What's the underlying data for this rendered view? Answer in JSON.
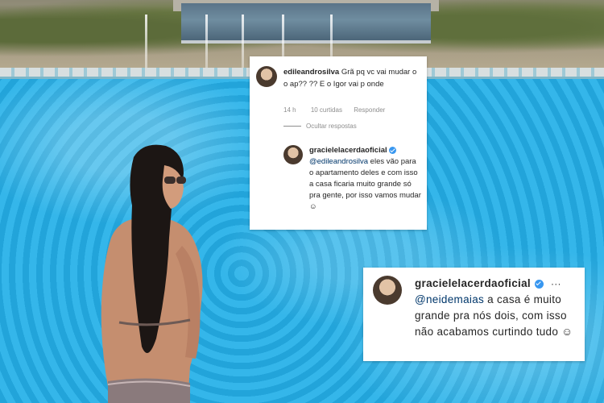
{
  "comment_card_1": {
    "parent_comment": {
      "username": "edileandrosilva",
      "text": "Grã pq vc vai mudar o o ap?? ?? E o Igor vai p onde",
      "time": "14 h",
      "likes": "10 curtidas",
      "reply_label": "Responder"
    },
    "hide_replies_label": "Ocultar respostas",
    "reply": {
      "username": "gracielelacerdaoficial",
      "mention": "@edileandrosilva",
      "text": " eles vão para o apartamento deles e com isso a casa ficaria muito grande só pra gente, por isso vamos mudar ☺"
    }
  },
  "comment_card_2": {
    "username": "gracielelacerdaoficial",
    "mention": "@neidemaias",
    "text": " a casa é muito grande pra nós dois, com isso não acabamos curtindo tudo ☺",
    "more_label": "···"
  },
  "colors": {
    "pool_blue": "#2fb2e6",
    "mention_blue": "#00376b",
    "verified_blue": "#3897f0",
    "meta_gray": "#8e8e8e"
  }
}
